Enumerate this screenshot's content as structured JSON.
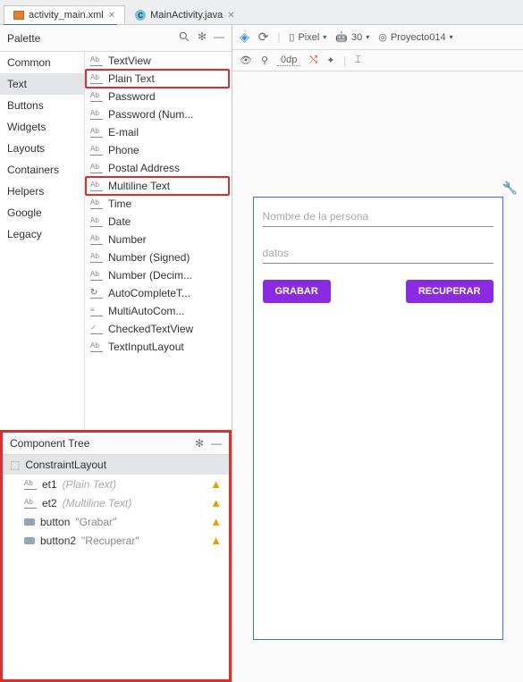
{
  "tabs": {
    "xml": "activity_main.xml",
    "java": "MainActivity.java"
  },
  "palette": {
    "title": "Palette",
    "categories": [
      "Common",
      "Text",
      "Buttons",
      "Widgets",
      "Layouts",
      "Containers",
      "Helpers",
      "Google",
      "Legacy"
    ],
    "selected_category": "Text",
    "widgets": [
      "TextView",
      "Plain Text",
      "Password",
      "Password (Num...",
      "E-mail",
      "Phone",
      "Postal Address",
      "Multiline Text",
      "Time",
      "Date",
      "Number",
      "Number (Signed)",
      "Number (Decim...",
      "AutoCompleteT...",
      "MultiAutoCom...",
      "CheckedTextView",
      "TextInputLayout"
    ]
  },
  "comp_tree": {
    "title": "Component Tree",
    "root": "ConstraintLayout",
    "items": [
      {
        "id": "et1",
        "type": "(Plain Text)"
      },
      {
        "id": "et2",
        "type": "(Multiline Text)"
      },
      {
        "id": "button",
        "quote": "\"Grabar\""
      },
      {
        "id": "button2",
        "quote": "\"Recuperar\""
      }
    ]
  },
  "design_bar": {
    "device": "Pixel",
    "api": "30",
    "project": "Proyecto014",
    "dp": "0dp"
  },
  "preview": {
    "hint1": "Nombre de la persona",
    "hint2": "datos",
    "btn1": "GRABAR",
    "btn2": "RECUPERAR"
  }
}
